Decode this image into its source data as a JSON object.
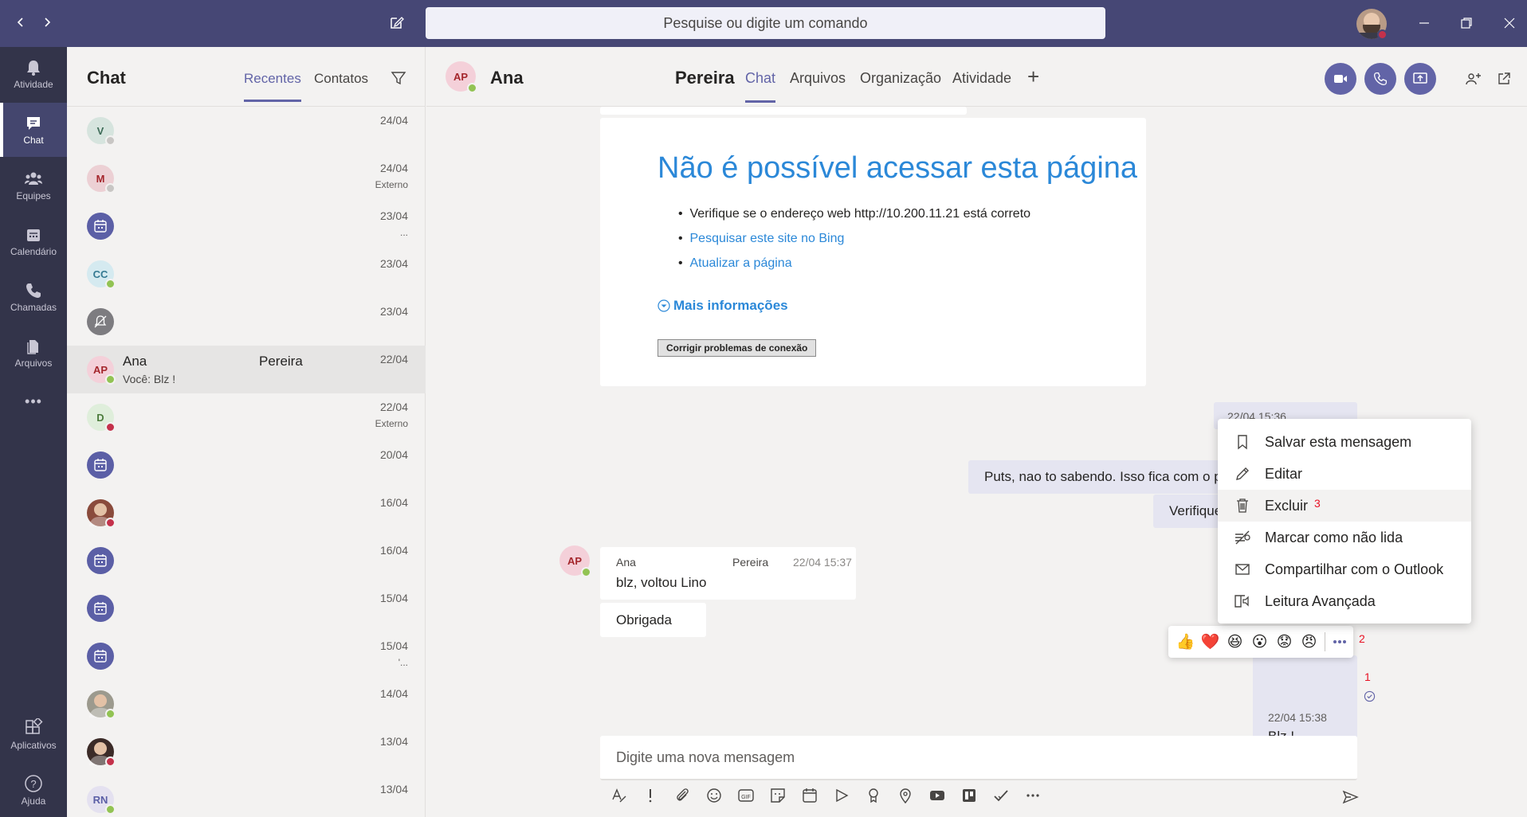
{
  "titlebar": {
    "search_placeholder": "Pesquise ou digite um comando"
  },
  "rail": {
    "items": [
      {
        "label": "Atividade",
        "icon": "bell-icon"
      },
      {
        "label": "Chat",
        "icon": "chat-icon"
      },
      {
        "label": "Equipes",
        "icon": "teams-icon"
      },
      {
        "label": "Calendário",
        "icon": "calendar-icon"
      },
      {
        "label": "Chamadas",
        "icon": "phone-icon"
      },
      {
        "label": "Arquivos",
        "icon": "files-icon"
      },
      {
        "label": "Aplicativos",
        "icon": "apps-icon"
      },
      {
        "label": "Ajuda",
        "icon": "help-icon"
      }
    ],
    "more_glyph": "•••"
  },
  "chatlist": {
    "title": "Chat",
    "tab_recent": "Recentes",
    "tab_contacts": "Contatos",
    "rows": [
      {
        "initials": "V",
        "name": "",
        "surname": "",
        "preview": "",
        "date": "24/04",
        "sub": ""
      },
      {
        "initials": "M",
        "name": "",
        "surname": "",
        "preview": "",
        "date": "24/04",
        "sub": "Externo"
      },
      {
        "initials": "",
        "name": "",
        "surname": "",
        "preview": "",
        "date": "23/04",
        "sub": "..."
      },
      {
        "initials": "CC",
        "name": "",
        "surname": "",
        "preview": "",
        "date": "23/04",
        "sub": ""
      },
      {
        "initials": "",
        "name": "",
        "surname": "",
        "preview": "",
        "date": "23/04",
        "sub": ""
      },
      {
        "initials": "AP",
        "name": "Ana",
        "surname": "Pereira",
        "preview": "Você: Blz !",
        "date": "22/04",
        "sub": ""
      },
      {
        "initials": "D",
        "name": "",
        "surname": "",
        "preview": "",
        "date": "22/04",
        "sub": "Externo"
      },
      {
        "initials": "",
        "name": "",
        "surname": "",
        "preview": "",
        "date": "20/04",
        "sub": ""
      },
      {
        "initials": "",
        "name": "",
        "surname": "",
        "preview": "",
        "date": "16/04",
        "sub": ""
      },
      {
        "initials": "",
        "name": "",
        "surname": "",
        "preview": "",
        "date": "16/04",
        "sub": ""
      },
      {
        "initials": "",
        "name": "",
        "surname": "",
        "preview": "",
        "date": "15/04",
        "sub": ""
      },
      {
        "initials": "",
        "name": "",
        "surname": "",
        "preview": "",
        "date": "15/04",
        "sub": "'..."
      },
      {
        "initials": "",
        "name": "",
        "surname": "",
        "preview": "",
        "date": "14/04",
        "sub": ""
      },
      {
        "initials": "",
        "name": "",
        "surname": "",
        "preview": "",
        "date": "13/04",
        "sub": ""
      },
      {
        "initials": "RN",
        "name": "",
        "surname": "",
        "preview": "",
        "date": "13/04",
        "sub": ""
      }
    ]
  },
  "header": {
    "initials": "AP",
    "name": "Ana",
    "surname": "Pereira",
    "tabs": [
      "Chat",
      "Arquivos",
      "Organização",
      "Atividade"
    ],
    "add_tab": "+"
  },
  "browser_error": {
    "title": "Não é possível acessar esta página",
    "bullet1": "Verifique se o endereço web http://10.200.11.21 está correto",
    "bullet2": "Pesquisar este site no Bing",
    "bullet3": "Atualizar a página",
    "more_info": "Mais informações",
    "fix_button": "Corrigir problemas de conexão"
  },
  "messages": {
    "sent_partial_1": "Puts, nao to sabendo. Isso fica com o p",
    "sent_partial_2": "Verifique",
    "sent_time_cut": "22/04 15:36",
    "ana_name": "Ana",
    "ana_surname": "Pereira",
    "ana_time": "22/04 15:37",
    "ana_msg1": "blz, voltou Lino",
    "ana_msg2": "Obrigada",
    "my_time": "22/04 15:38",
    "my_msg": "Blz !"
  },
  "context_menu": {
    "items": [
      {
        "label": "Salvar esta mensagem",
        "icon": "bookmark-icon"
      },
      {
        "label": "Editar",
        "icon": "pencil-icon"
      },
      {
        "label": "Excluir",
        "icon": "trash-icon"
      },
      {
        "label": "Marcar como não lida",
        "icon": "unread-icon"
      },
      {
        "label": "Compartilhar com o Outlook",
        "icon": "mail-icon"
      },
      {
        "label": "Leitura Avançada",
        "icon": "immersive-reader-icon"
      }
    ]
  },
  "reactions": [
    "👍",
    "❤️",
    "😆",
    "😮",
    "😟",
    "😠"
  ],
  "annotations": {
    "one": "1",
    "two": "2",
    "three": "3"
  },
  "compose": {
    "placeholder": "Digite uma nova mensagem"
  },
  "colors": {
    "brand": "#6264a7",
    "titlebar": "#464775",
    "rail": "#33344a",
    "link": "#2b88d8"
  }
}
